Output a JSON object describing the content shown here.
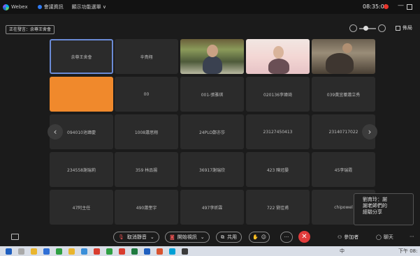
{
  "titlebar": {
    "app_name": "Webex",
    "security_label": "會議資訊",
    "meeting_info": "顯示功能選單 ∨",
    "clock": "08:35:01"
  },
  "subbar": {
    "speaker_label": "正在發言：余尊王舍會",
    "layout_label": "佈局"
  },
  "tiles": [
    {
      "label": "余尊王舍會",
      "type": "name"
    },
    {
      "label": "辛貴翔",
      "type": "name"
    },
    {
      "label": "",
      "type": "video1"
    },
    {
      "label": "",
      "type": "video2"
    },
    {
      "label": "",
      "type": "video3"
    },
    {
      "label": "",
      "type": "orange"
    },
    {
      "label": "00",
      "type": "name"
    },
    {
      "label": "001-張雅琪",
      "type": "name"
    },
    {
      "label": "020136李瑋琦",
      "type": "name"
    },
    {
      "label": "039黃宜蓁蕭立秀",
      "type": "name"
    },
    {
      "label": "094010池瑋慶",
      "type": "name"
    },
    {
      "label": "1008蕭思翔",
      "type": "name"
    },
    {
      "label": "24PLO鄭亦莎",
      "type": "name"
    },
    {
      "label": "23127450413",
      "type": "name"
    },
    {
      "label": "23140717022",
      "type": "name"
    },
    {
      "label": "234558謝瑞莉",
      "type": "name"
    },
    {
      "label": "359 林品揚",
      "type": "name"
    },
    {
      "label": "36917謝瑞欣",
      "type": "name"
    },
    {
      "label": "423 陳冠晏",
      "type": "name"
    },
    {
      "label": "45李瑞霞",
      "type": "name"
    },
    {
      "label": "47阿主任",
      "type": "name"
    },
    {
      "label": "490蕭奎宇",
      "type": "name"
    },
    {
      "label": "497李昕霖",
      "type": "name"
    },
    {
      "label": "722 劉佳甫",
      "type": "name"
    },
    {
      "label": "chipowel",
      "type": "name"
    }
  ],
  "chat_popup": {
    "line1": "劉育玲：謝",
    "line2": "謝老師們的",
    "line3": "經驗分享"
  },
  "controls": {
    "mute_label": "取消靜音",
    "video_label": "開始視訊",
    "share_label": "共用",
    "participants_label": "參加者",
    "chat_label": "聊天",
    "more": "···"
  },
  "taskbar": {
    "ime": "中",
    "time": "下午 08:"
  },
  "colors": {
    "accent_orange": "#f0892c",
    "end_red": "#e23b3b",
    "active_border": "#6b8bd6"
  }
}
